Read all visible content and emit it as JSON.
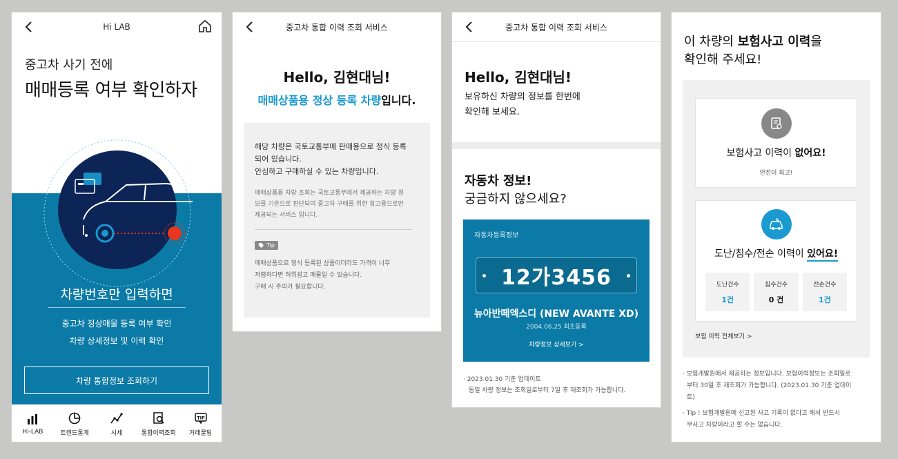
{
  "screen1": {
    "header_title": "Hi LAB",
    "subtitle": "중고차 사기 전에",
    "title": "매매등록 여부 확인하자",
    "main_text": "차량번호만 입력하면",
    "line1": "중고차 정상매물 등록 여부 확인",
    "line2": "차량 상세정보 및 이력 확인",
    "button": "차량 통합정보 조회하기",
    "nav": [
      "Hi-LAB",
      "트렌드통계",
      "시세",
      "통합이력조회",
      "거래꿀팁"
    ],
    "colors": {
      "primary": "#0b7aa6",
      "navy": "#0d2456",
      "red": "#e8361f"
    }
  },
  "screen2": {
    "header_title": "중고차 통합 이력 조회 서비스",
    "hello": "Hello, 김현대님!",
    "status_highlight": "매매상품용 정상 등록 차량",
    "status_rest": "입니다.",
    "info_main1": "해당 차량은 국토교통부에 판매용으로 정식 등록",
    "info_main2": "되어 있습니다.",
    "info_main3": "안심하고 구매하실 수 있는 차량입니다.",
    "info_sub1": "매매상품용 차량 조회는 국토교통부에서 제공하는 차량 정",
    "info_sub2": "보를 기준으로 판단되며 중고차 구매를 위한 참고용으로만",
    "info_sub3": "제공되는 서비스 입니다.",
    "tip_label": "Tip",
    "tip1": "매매상품으로 정식 등록된 상품이더라도 가격이 너무",
    "tip2": "저렴하다면 허위광고 매물일 수 있습니다.",
    "tip3": "구매 시 주의가 필요합니다."
  },
  "screen3": {
    "header_title": "중고차 통합 이력 조회 서비스",
    "hello": "Hello, 김현대님!",
    "desc1": "보유하신 차량의 정보를 한번에",
    "desc2": "확인해 보세요.",
    "question1": "자동차 정보!",
    "question2": "궁금하지 않으세요?",
    "card_label": "자동차등록정보",
    "plate": "12가3456",
    "model": "뉴아반떼엑스디 (NEW AVANTE XD)",
    "first_reg": "2004.06.25 최초등록",
    "detail_link": "차량정보 상세보기 >",
    "note1": "· 2023.01.30 기준 업데이트",
    "note2": "동일 차량 정보는 조회일로부터 7일 후 재조회가 가능합니다."
  },
  "screen4": {
    "title_pre": "이 차량의 ",
    "title_bold": "보험사고 이력",
    "title_post": "을",
    "title_line2": "확인해 주세요!",
    "card1_head_pre": "보험사고 이력이 ",
    "card1_head_bold": "없어요!",
    "card1_sub": "안전이 최고!",
    "card2_head_pre": "도난/침수/전손 이력이 ",
    "card2_head_bold": "있어요!",
    "stats": [
      {
        "label": "도난건수",
        "value": "1건",
        "color": "#1a9ad0"
      },
      {
        "label": "침수건수",
        "value": "0 건",
        "color": "#111111"
      },
      {
        "label": "전손건수",
        "value": "1건",
        "color": "#1a9ad0"
      }
    ],
    "link": "보험 이력 전체보기 >",
    "note1a": "· 보험개발원에서 제공하는 정보입니다. 보험이력정보는 조회일로",
    "note1b": "부터 30일 후 재조회가 가능합니다. (2023.01.30 기준 업데이",
    "note1c": "트)",
    "note2a": "· Tip ! 보험개발원에 신고된 사고 기록이 없다고 해서 반드시",
    "note2b": "무사고 차량이라고 할 수는 없습니다."
  }
}
